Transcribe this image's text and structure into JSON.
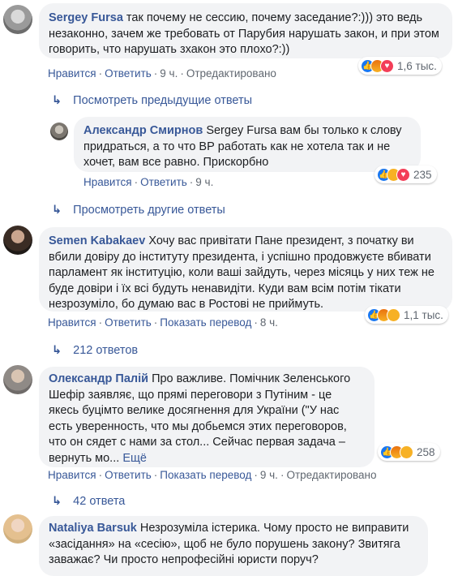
{
  "comments": [
    {
      "author": "Sergey Fursa",
      "text": "так почему не сессию, почему заседание?:))) это ведь незаконно, зачем же требовать от Парубия нарушать закон, и при этом говорить, что нарушать зхакон это плохо?:))",
      "like": "Нравится",
      "reply": "Ответить",
      "time": "9 ч.",
      "edited": "Отредактировано",
      "reactions_count": "1,6 тыс.",
      "reactions": [
        "like-icon",
        "angry-icon",
        "love-icon"
      ]
    },
    {
      "author": "Александр Смирнов",
      "text": "Sergey Fursa вам бы только к слову придраться, а то что ВР работать как не хотела так и не хочет, вам все равно. Прискорбно",
      "like": "Нравится",
      "reply": "Ответить",
      "time": "9 ч.",
      "reactions_count": "235",
      "reactions": [
        "like-icon",
        "haha-icon",
        "love-icon"
      ]
    },
    {
      "author": "Semen Kabakaev",
      "text": "Хочу вас привітати Пане президент, з початку ви вбили довіру до інституту президента, і успішно продовжуєте вбивати парламент як інституцію, коли ваші зайдуть, через місяць у них теж не буде довіри і їх всі будуть ненавидіти. Куди вам всім потім тікати незрозуміло, бо думаю вас в Ростові не приймуть.",
      "like": "Нравится",
      "reply": "Ответить",
      "translate": "Показать перевод",
      "time": "8 ч.",
      "reactions_count": "1,1 тыс.",
      "reactions": [
        "like-icon",
        "angry-icon",
        "haha-icon"
      ]
    },
    {
      "author": "Олександр Палій",
      "text": "Про важливе. Помічник Зеленського Шефір заявляє, що прямі переговори з Путіним - це якесь буцімто велике досягнення для України (\"У нас есть уверенность, что мы добьемся этих переговоров, что он сядет с нами за стол... Сейчас первая задача – вернуть мо...",
      "see_more": "Ещё",
      "like": "Нравится",
      "reply": "Ответить",
      "translate": "Показать перевод",
      "time": "9 ч.",
      "edited": "Отредактировано",
      "reactions_count": "258",
      "reactions": [
        "like-icon",
        "angry-icon",
        "haha-icon"
      ]
    },
    {
      "author": "Nataliya Barsuk",
      "text": "Незрозуміла істерика. Чому просто не виправити «засідання» на «сесію», щоб не було порушень закону? Звитяга заважає? Чи просто непрофесійні юристи поруч?"
    }
  ],
  "reply_links": {
    "previous": "Посмотреть предыдущие ответы",
    "other": "Просмотреть другие ответы",
    "count_1": "212 ответов",
    "count_2": "42 ответа"
  },
  "colors": {
    "link": "#385898",
    "bubble": "#f2f3f5",
    "muted": "#606770"
  }
}
